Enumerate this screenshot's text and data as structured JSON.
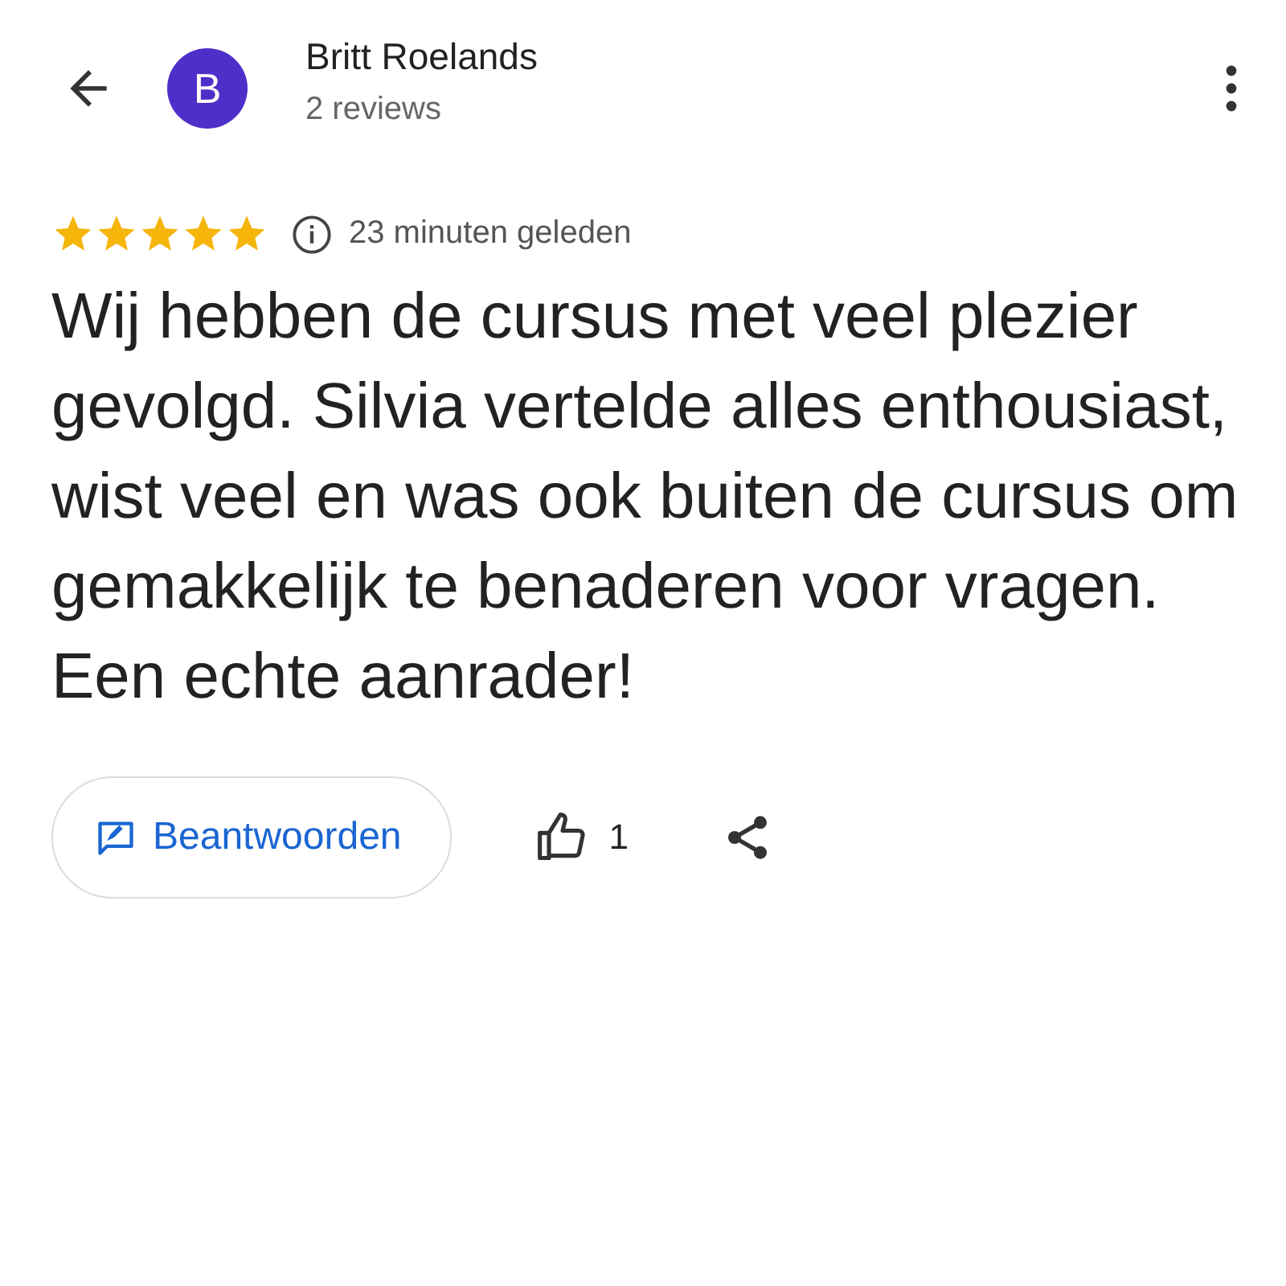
{
  "reviewer": {
    "initial": "B",
    "name": "Britt Roelands",
    "reviews": "2 reviews"
  },
  "review": {
    "stars": 5,
    "time": "23 minuten geleden",
    "text": "Wij hebben de cursus met veel plezier gevolgd. Silvia vertelde alles enthousiast, wist veel en was ook buiten de cursus om gemakkelijk te benaderen voor vragen. Een echte aanrader!"
  },
  "actions": {
    "reply_label": "Beantwoorden",
    "likes": "1"
  }
}
